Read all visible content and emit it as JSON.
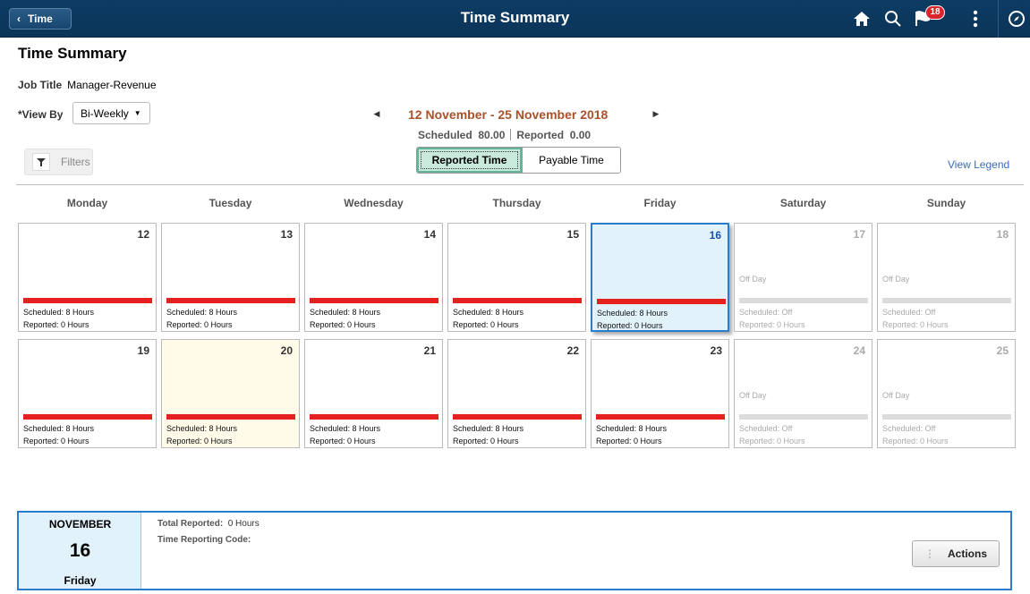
{
  "banner": {
    "back_label": "Time",
    "title": "Time Summary",
    "notification_count": "18",
    "icons": [
      "home-icon",
      "search-icon",
      "notifications-icon",
      "more-options-icon",
      "navbar-compass-icon"
    ]
  },
  "page": {
    "title": "Time Summary",
    "job_title_label": "Job Title",
    "job_title_value": "Manager-Revenue",
    "view_by_required": "*",
    "view_by_label": "View By",
    "view_by_value": "Bi-Weekly"
  },
  "period": {
    "range": "12 November - 25 November 2018",
    "scheduled_label": "Scheduled",
    "scheduled_value": "80.00",
    "reported_label": "Reported",
    "reported_value": "0.00"
  },
  "filters_label": "Filters",
  "toggle": {
    "reported_time": "Reported Time",
    "payable_time": "Payable Time",
    "active": "Reported Time"
  },
  "view_legend": "View Legend",
  "weekdays": [
    "Monday",
    "Tuesday",
    "Wednesday",
    "Thursday",
    "Friday",
    "Saturday",
    "Sunday"
  ],
  "weeks": [
    [
      {
        "day": "12",
        "type": "work",
        "line1": "Scheduled: 8 Hours",
        "line2": "Reported: 0 Hours"
      },
      {
        "day": "13",
        "type": "work",
        "line1": "Scheduled: 8 Hours",
        "line2": "Reported: 0 Hours"
      },
      {
        "day": "14",
        "type": "work",
        "line1": "Scheduled: 8 Hours",
        "line2": "Reported: 0 Hours"
      },
      {
        "day": "15",
        "type": "work",
        "line1": "Scheduled: 8 Hours",
        "line2": "Reported: 0 Hours"
      },
      {
        "day": "16",
        "type": "selected",
        "line1": "Scheduled: 8 Hours",
        "line2": "Reported: 0 Hours"
      },
      {
        "day": "17",
        "type": "off",
        "off_label": "Off Day",
        "line1": "Scheduled: Off",
        "line2": "Reported: 0 Hours"
      },
      {
        "day": "18",
        "type": "off",
        "off_label": "Off Day",
        "line1": "Scheduled: Off",
        "line2": "Reported: 0 Hours"
      }
    ],
    [
      {
        "day": "19",
        "type": "work",
        "line1": "Scheduled: 8 Hours",
        "line2": "Reported: 0 Hours"
      },
      {
        "day": "20",
        "type": "today",
        "line1": "Scheduled: 8 Hours",
        "line2": "Reported: 0 Hours"
      },
      {
        "day": "21",
        "type": "work",
        "line1": "Scheduled: 8 Hours",
        "line2": "Reported: 0 Hours"
      },
      {
        "day": "22",
        "type": "work",
        "line1": "Scheduled: 8 Hours",
        "line2": "Reported: 0 Hours"
      },
      {
        "day": "23",
        "type": "work",
        "line1": "Scheduled: 8 Hours",
        "line2": "Reported: 0 Hours"
      },
      {
        "day": "24",
        "type": "off",
        "off_label": "Off Day",
        "line1": "Scheduled: Off",
        "line2": "Reported: 0 Hours"
      },
      {
        "day": "25",
        "type": "off",
        "off_label": "Off Day",
        "line1": "Scheduled: Off",
        "line2": "Reported: 0 Hours"
      }
    ]
  ],
  "detail": {
    "month": "NOVEMBER",
    "day": "16",
    "weekday": "Friday",
    "total_reported_label": "Total Reported:",
    "total_reported_value": "0 Hours",
    "trc_label": "Time Reporting Code:",
    "actions_label": "Actions"
  },
  "colors": {
    "banner": "#0b3458",
    "scheduled_bar": "#e5201f",
    "off_bar": "#dcdcdc",
    "selected_bg": "#e2f2fb",
    "today_bg": "#fffbe8",
    "period_text": "#a8522c",
    "link": "#3a6db8"
  }
}
